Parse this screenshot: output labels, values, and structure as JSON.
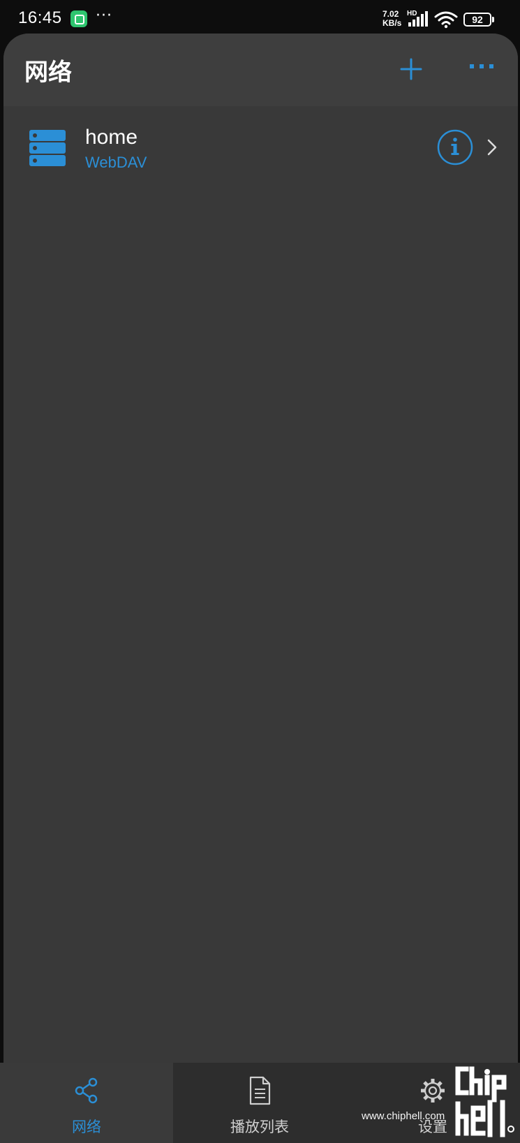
{
  "status_bar": {
    "time": "16:45",
    "network_speed_value": "7.02",
    "network_speed_unit": "KB/s",
    "network_type": "HD",
    "battery": "92",
    "more": "···",
    "app_icon": "mi-home-icon"
  },
  "header": {
    "title": "网络",
    "add_icon": "plus-icon",
    "more_icon": "more-dots-icon",
    "accent_color": "#2b8fd6"
  },
  "servers": [
    {
      "name": "home",
      "type": "WebDAV",
      "icon": "server-icon",
      "info_icon": "info-icon",
      "chevron_icon": "chevron-right-icon"
    }
  ],
  "bottom_nav": {
    "tabs": [
      {
        "label": "网络",
        "icon": "share-icon",
        "active": true
      },
      {
        "label": "播放列表",
        "icon": "document-icon",
        "active": false
      },
      {
        "label": "设置",
        "icon": "gear-icon",
        "active": false
      }
    ]
  },
  "watermark": {
    "url": "www.chiphell.com",
    "logo": "chiphell-logo"
  },
  "colors": {
    "background": "#393939",
    "header": "#3e3e3e",
    "nav": "#2d2d2d",
    "accent": "#2b8fd6",
    "status_bar": "#0d0d0d"
  }
}
